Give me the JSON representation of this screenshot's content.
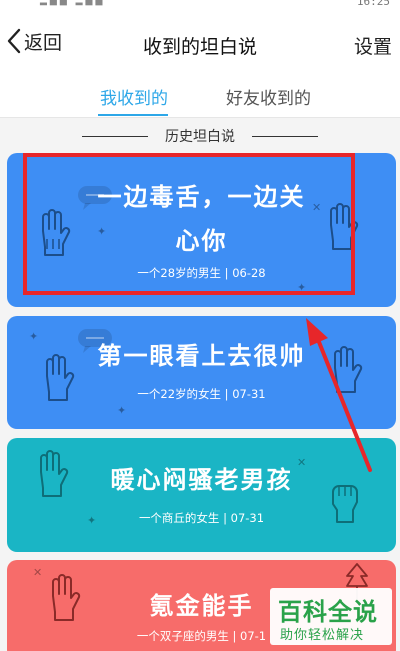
{
  "status_bar": {
    "time": "16:25"
  },
  "nav": {
    "back_label": "返回",
    "title": "收到的坦白说",
    "settings_label": "设置"
  },
  "tabs": [
    {
      "label": "我收到的",
      "active": true
    },
    {
      "label": "好友收到的",
      "active": false
    }
  ],
  "section": {
    "title": "历史坦白说"
  },
  "cards": [
    {
      "title": "一边毒舌，一边关心你",
      "meta": "一个28岁的男生 | 06-28",
      "color": "#3e8ef4"
    },
    {
      "title": "第一眼看上去很帅",
      "meta": "一个22岁的女生 | 07-31",
      "color": "#3e8ef4"
    },
    {
      "title": "暖心闷骚老男孩",
      "meta": "一个商丘的女生 | 07-31",
      "color": "#1ab5c5"
    },
    {
      "title": "氪金能手",
      "meta": "一个双子座的男生 | 07-1",
      "color": "#f76c6a"
    }
  ],
  "annotation": {
    "highlight_color": "#e7262a"
  },
  "watermark": {
    "main": "百科全说",
    "sub": "助你轻松解决"
  }
}
